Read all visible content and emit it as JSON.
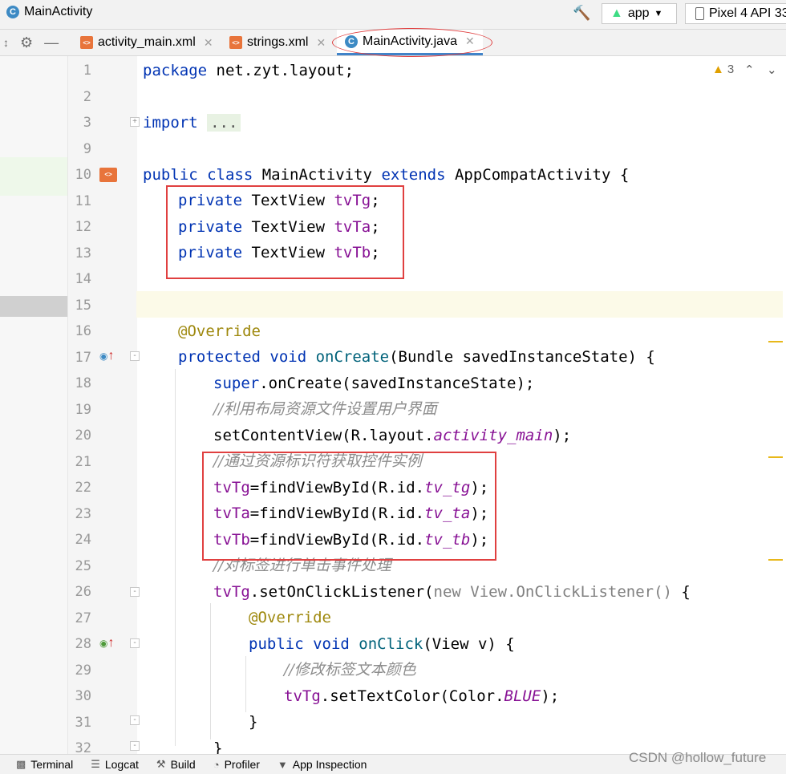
{
  "titlebar": {
    "title": "MainActivity",
    "run_config": "app",
    "device": "Pixel 4 API 33"
  },
  "tabs": [
    {
      "label": "activity_main.xml",
      "active": false
    },
    {
      "label": "strings.xml",
      "active": false
    },
    {
      "label": "MainActivity.java",
      "active": true
    }
  ],
  "editor": {
    "warning_count": "3",
    "line_numbers": [
      "1",
      "2",
      "3",
      "9",
      "10",
      "11",
      "12",
      "13",
      "14",
      "15",
      "16",
      "17",
      "18",
      "19",
      "20",
      "21",
      "22",
      "23",
      "24",
      "25",
      "26",
      "27",
      "28",
      "29",
      "30",
      "31",
      "32"
    ],
    "code": {
      "l1_kw": "package",
      "l1_rest": " net.zyt.layout;",
      "l3_kw": "import",
      "l3_fold": "...",
      "l10_a": "public class",
      "l10_b": " MainActivity ",
      "l10_c": "extends",
      "l10_d": " AppCompatActivity {",
      "l11_kw": "private",
      "l11_type": " TextView ",
      "l11_var": "tvTg",
      "l11_end": ";",
      "l12_kw": "private",
      "l12_type": " TextView ",
      "l12_var": "tvTa",
      "l12_end": ";",
      "l13_kw": "private",
      "l13_type": " TextView ",
      "l13_var": "tvTb",
      "l13_end": ";",
      "l16_an": "@Override",
      "l17_a": "protected void",
      "l17_m": " onCreate",
      "l17_rest": "(Bundle savedInstanceState) {",
      "l18_kw": "super",
      "l18_rest": ".onCreate(savedInstanceState);",
      "l19_cm": "//利用布局资源文件设置用户界面",
      "l20_a": "setContentView(R.layout.",
      "l20_it": "activity_main",
      "l20_b": ");",
      "l21_cm": "//通过资源标识符获取控件实例",
      "l22_v": "tvTg",
      "l22_a": "=findViewById(R.id.",
      "l22_it": "tv_tg",
      "l22_b": ");",
      "l23_v": "tvTa",
      "l23_a": "=findViewById(R.id.",
      "l23_it": "tv_ta",
      "l23_b": ");",
      "l24_v": "tvTb",
      "l24_a": "=findViewById(R.id.",
      "l24_it": "tv_tb",
      "l24_b": ");",
      "l25_cm": "//对标签进行单击事件处理",
      "l26_v": "tvTg",
      "l26_a": ".setOnClickListener(",
      "l26_g": "new View.OnClickListener()",
      "l26_b": " {",
      "l27_an": "@Override",
      "l28_a": "public void",
      "l28_m": " onClick",
      "l28_rest": "(View v) {",
      "l29_cm": "//修改标签文本颜色",
      "l30_v": "tvTg",
      "l30_a": ".setTextColor(Color.",
      "l30_it": "BLUE",
      "l30_b": ");",
      "l31": "}",
      "l32": "}"
    }
  },
  "bottombar": {
    "terminal": "Terminal",
    "logcat": "Logcat",
    "build": "Build",
    "profiler": "Profiler",
    "app_inspection": "App Inspection"
  },
  "watermark": "CSDN @hollow_future",
  "colors": {
    "keyword": "#0033b3",
    "field": "#871094",
    "method": "#00627a",
    "annotation": "#9e880d",
    "comment": "#8c8c8c",
    "highlight_box": "#e04040"
  }
}
